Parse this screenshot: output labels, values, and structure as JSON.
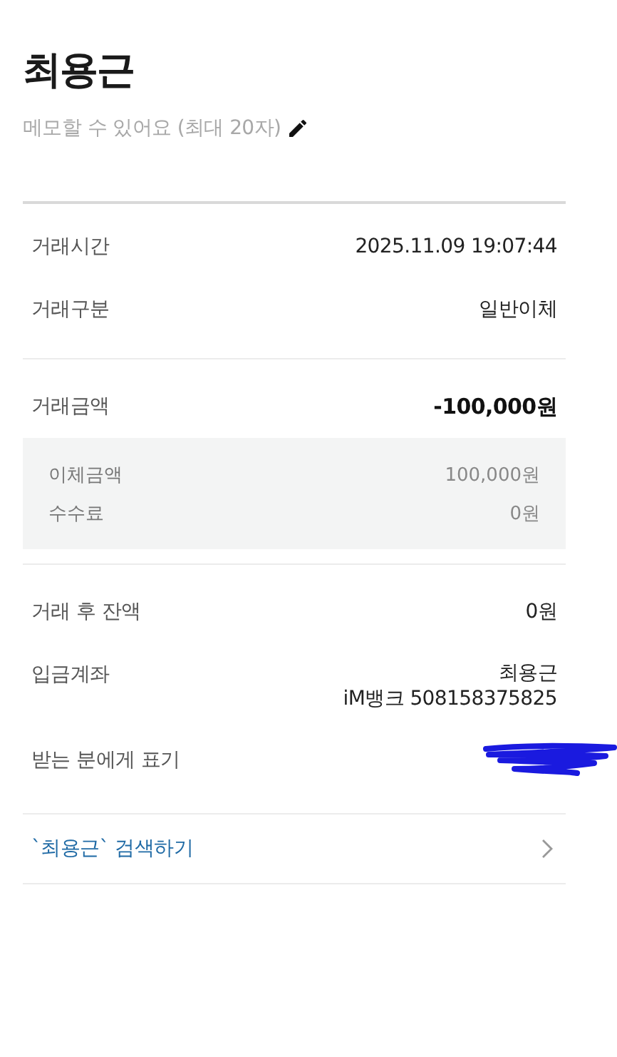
{
  "header": {
    "name": "최용근",
    "memo_placeholder": "메모할 수 있어요 (최대 20자)"
  },
  "sections": [
    {
      "rows": [
        {
          "kind": "text",
          "label": "거래시간",
          "values": [
            "2025.11.09 19:07:44"
          ],
          "emphasis": false
        },
        {
          "kind": "text",
          "label": "거래구분",
          "values": [
            "일반이체"
          ],
          "emphasis": false
        }
      ]
    },
    {
      "rows": [
        {
          "kind": "text",
          "label": "거래금액",
          "values": [
            "-100,000원"
          ],
          "emphasis": true
        }
      ],
      "breakdown": [
        {
          "label": "이체금액",
          "value": "100,000원"
        },
        {
          "label": "수수료",
          "value": "0원"
        }
      ]
    },
    {
      "rows": [
        {
          "kind": "text",
          "label": "거래 후 잔액",
          "values": [
            "0원"
          ],
          "emphasis": false
        },
        {
          "kind": "text",
          "label": "입금계좌",
          "values": [
            "최용근",
            "iM뱅크 508158375825"
          ],
          "emphasis": false
        },
        {
          "kind": "redacted",
          "label": "받는 분에게 표기"
        }
      ]
    }
  ],
  "search_link": {
    "label": "`최용근` 검색하기"
  }
}
